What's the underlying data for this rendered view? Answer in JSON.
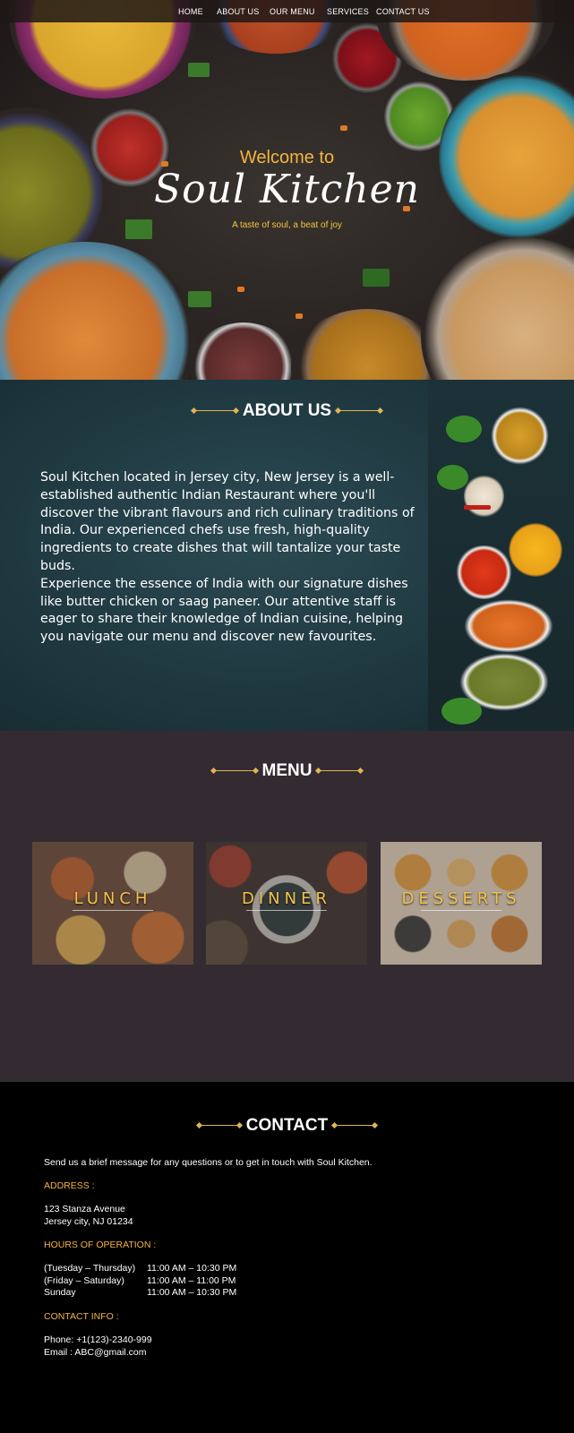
{
  "nav": {
    "items": [
      "HOME",
      "ABOUT US",
      "OUR MENU",
      "SERVICES",
      "CONTACT US"
    ]
  },
  "hero": {
    "welcome": "Welcome to",
    "title": "Soul Kitchen",
    "tagline": "A taste of soul, a beat of joy"
  },
  "about": {
    "heading": "ABOUT US",
    "paragraph1": "Soul Kitchen located in Jersey city, New Jersey is a well-established authentic Indian Restaurant where you'll discover the vibrant flavours and rich culinary traditions of India. Our experienced chefs use fresh, high-quality ingredients to create dishes that will tantalize your taste buds.",
    "paragraph2": "Experience the essence of India with our signature dishes like butter chicken or saag paneer. Our attentive staff is eager to share their knowledge of Indian cuisine, helping you navigate our menu and discover new favourites."
  },
  "menu": {
    "heading": "MENU",
    "cards": [
      "LUNCH",
      "DINNER",
      "DESSERTS"
    ]
  },
  "contact": {
    "heading": "CONTACT",
    "intro": "Send us a brief message for any questions or to get in touch with Soul Kitchen.",
    "address_label": "ADDRESS :",
    "address_line1": "123 Stanza Avenue",
    "address_line2": "Jersey city, NJ 01234",
    "hours_label": "HOURS OF OPERATION :",
    "hours": [
      {
        "day": "(Tuesday – Thursday)",
        "time": "11:00 AM – 10:30 PM"
      },
      {
        "day": "(Friday – Saturday)",
        "time": "11:00 AM – 11:00 PM"
      },
      {
        "day": "Sunday",
        "time": "11:00 AM – 10:30 PM"
      }
    ],
    "info_label": "CONTACT INFO :",
    "phone": "Phone: +1(123)-2340-999",
    "email": "Email : ABC@gmail.com"
  },
  "colors": {
    "accent_gold": "#f4b43e",
    "about_bg": "#203a42",
    "menu_bg": "#332b31",
    "contact_bg": "#000000"
  }
}
